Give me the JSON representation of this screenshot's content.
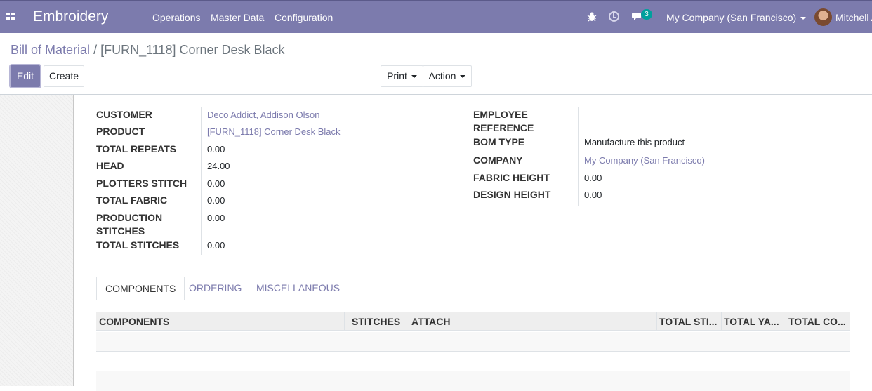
{
  "navbar": {
    "app_name": "Embroidery",
    "menu": [
      "Operations",
      "Master Data",
      "Configuration"
    ],
    "messages_count": "3",
    "company": "My Company (San Francisco)",
    "user": "Mitchell A"
  },
  "breadcrumb": {
    "parent": "Bill of Material",
    "separator": "/",
    "current": "[FURN_1118] Corner Desk Black"
  },
  "buttons": {
    "edit": "Edit",
    "create": "Create",
    "print": "Print",
    "action": "Action"
  },
  "form": {
    "left": [
      {
        "label": "CUSTOMER",
        "value": "Deco Addict, Addison Olson"
      },
      {
        "label": "PRODUCT",
        "value": "[FURN_1118] Corner Desk Black"
      },
      {
        "label": "TOTAL REPEATS",
        "value": "0.00"
      },
      {
        "label": "HEAD",
        "value": "24.00"
      },
      {
        "label": "PLOTTERS STITCH",
        "value": "0.00"
      },
      {
        "label": "TOTAL FABRIC",
        "value": "0.00"
      },
      {
        "label": "PRODUCTION STITCHES",
        "value": "0.00"
      },
      {
        "label": "TOTAL STITCHES",
        "value": "0.00"
      }
    ],
    "right": [
      {
        "label": "EMPLOYEE REFERENCE",
        "value": ""
      },
      {
        "label": "BOM TYPE",
        "value": "Manufacture this product"
      },
      {
        "label": "COMPANY",
        "value": "My Company (San Francisco)"
      },
      {
        "label": "FABRIC HEIGHT",
        "value": "0.00"
      },
      {
        "label": "DESIGN HEIGHT",
        "value": "0.00"
      }
    ]
  },
  "tabs": [
    "COMPONENTS",
    "ORDERING",
    "MISCELLANEOUS"
  ],
  "table": {
    "columns": [
      "COMPONENTS",
      "STITCHES",
      "ATTACH",
      "TOTAL STI...",
      "TOTAL YA...",
      "TOTAL CO..."
    ]
  },
  "colors": {
    "brand": "#7c7bad",
    "link": "#7c7bad",
    "badge": "#00a09d"
  }
}
